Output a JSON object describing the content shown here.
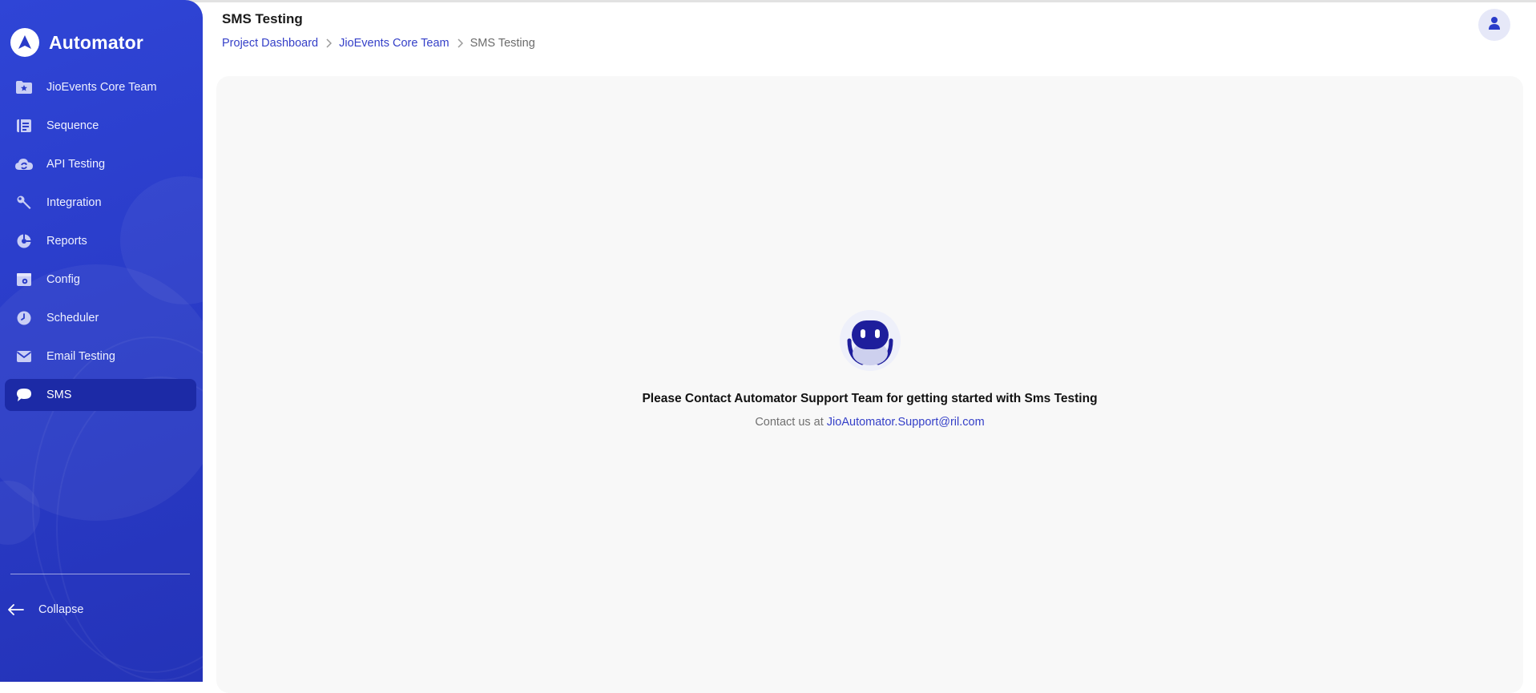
{
  "app": {
    "name": "Automator"
  },
  "sidebar": {
    "items": [
      {
        "label": "JioEvents Core Team",
        "icon": "folder-star-icon"
      },
      {
        "label": "Sequence",
        "icon": "sequence-icon"
      },
      {
        "label": "API Testing",
        "icon": "cloud-sync-icon"
      },
      {
        "label": "Integration",
        "icon": "wrench-icon"
      },
      {
        "label": "Reports",
        "icon": "pie-chart-icon"
      },
      {
        "label": "Config",
        "icon": "config-window-icon"
      },
      {
        "label": "Scheduler",
        "icon": "clock-icon"
      },
      {
        "label": "Email Testing",
        "icon": "envelope-icon"
      },
      {
        "label": "SMS",
        "icon": "chat-bubble-icon",
        "active": true
      }
    ],
    "collapse_label": "Collapse"
  },
  "header": {
    "title": "SMS Testing",
    "breadcrumb": [
      "Project Dashboard",
      "JioEvents Core Team",
      "SMS Testing"
    ]
  },
  "empty_state": {
    "heading": "Please Contact Automator Support Team for getting started with Sms Testing",
    "contact_prefix": "Contact us at",
    "email": "JioAutomator.Support@ril.com"
  },
  "colors": {
    "sidebar": "#2a3cc9",
    "sidebar_active": "#1c2aa6",
    "link": "#3540c8",
    "panel": "#f8f8f8"
  }
}
